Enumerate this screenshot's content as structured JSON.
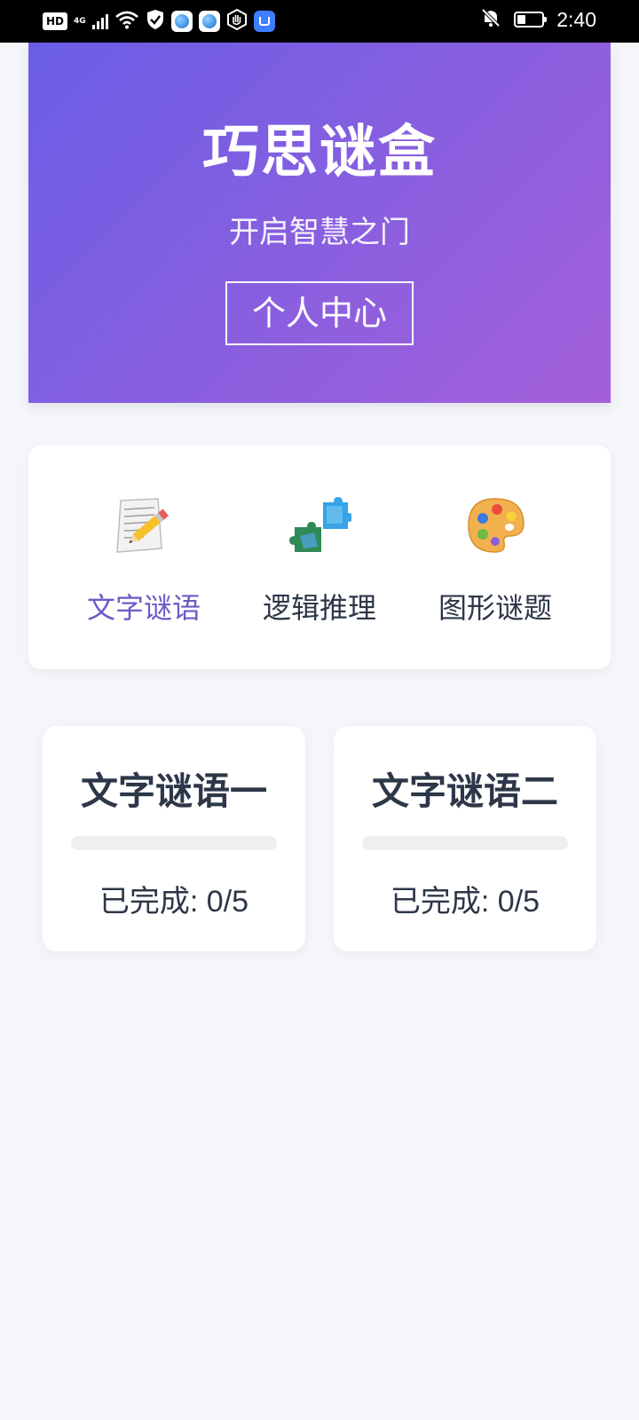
{
  "status_bar": {
    "network_badge": "HD",
    "network_type": "4G",
    "time": "2:40",
    "battery_level": 0.35,
    "icons": [
      "hd-icon",
      "cellular-signal-icon",
      "wifi-icon",
      "shield-icon",
      "browser-globe-icon",
      "browser-globe-icon",
      "hand-stop-icon",
      "app-store-bag-icon",
      "bell-muted-icon",
      "battery-icon"
    ]
  },
  "hero": {
    "title": "巧思谜盒",
    "subtitle": "开启智慧之门",
    "profile_button": "个人中心"
  },
  "categories": [
    {
      "label": "文字谜语",
      "icon": "pencil-paper-icon",
      "active": true
    },
    {
      "label": "逻辑推理",
      "icon": "puzzle-pieces-icon",
      "active": false
    },
    {
      "label": "图形谜题",
      "icon": "paint-palette-icon",
      "active": false
    }
  ],
  "levels": [
    {
      "title": "文字谜语一",
      "status": "已完成: 0/5",
      "progress": 0.0
    },
    {
      "title": "文字谜语二",
      "status": "已完成: 0/5",
      "progress": 0.0
    }
  ],
  "colors": {
    "hero_gradient_start": "#6a5ee6",
    "hero_gradient_end": "#a45fda",
    "active_tab": "#6b5bc6",
    "background": "#f5f6fa",
    "text": "#2d3748"
  }
}
